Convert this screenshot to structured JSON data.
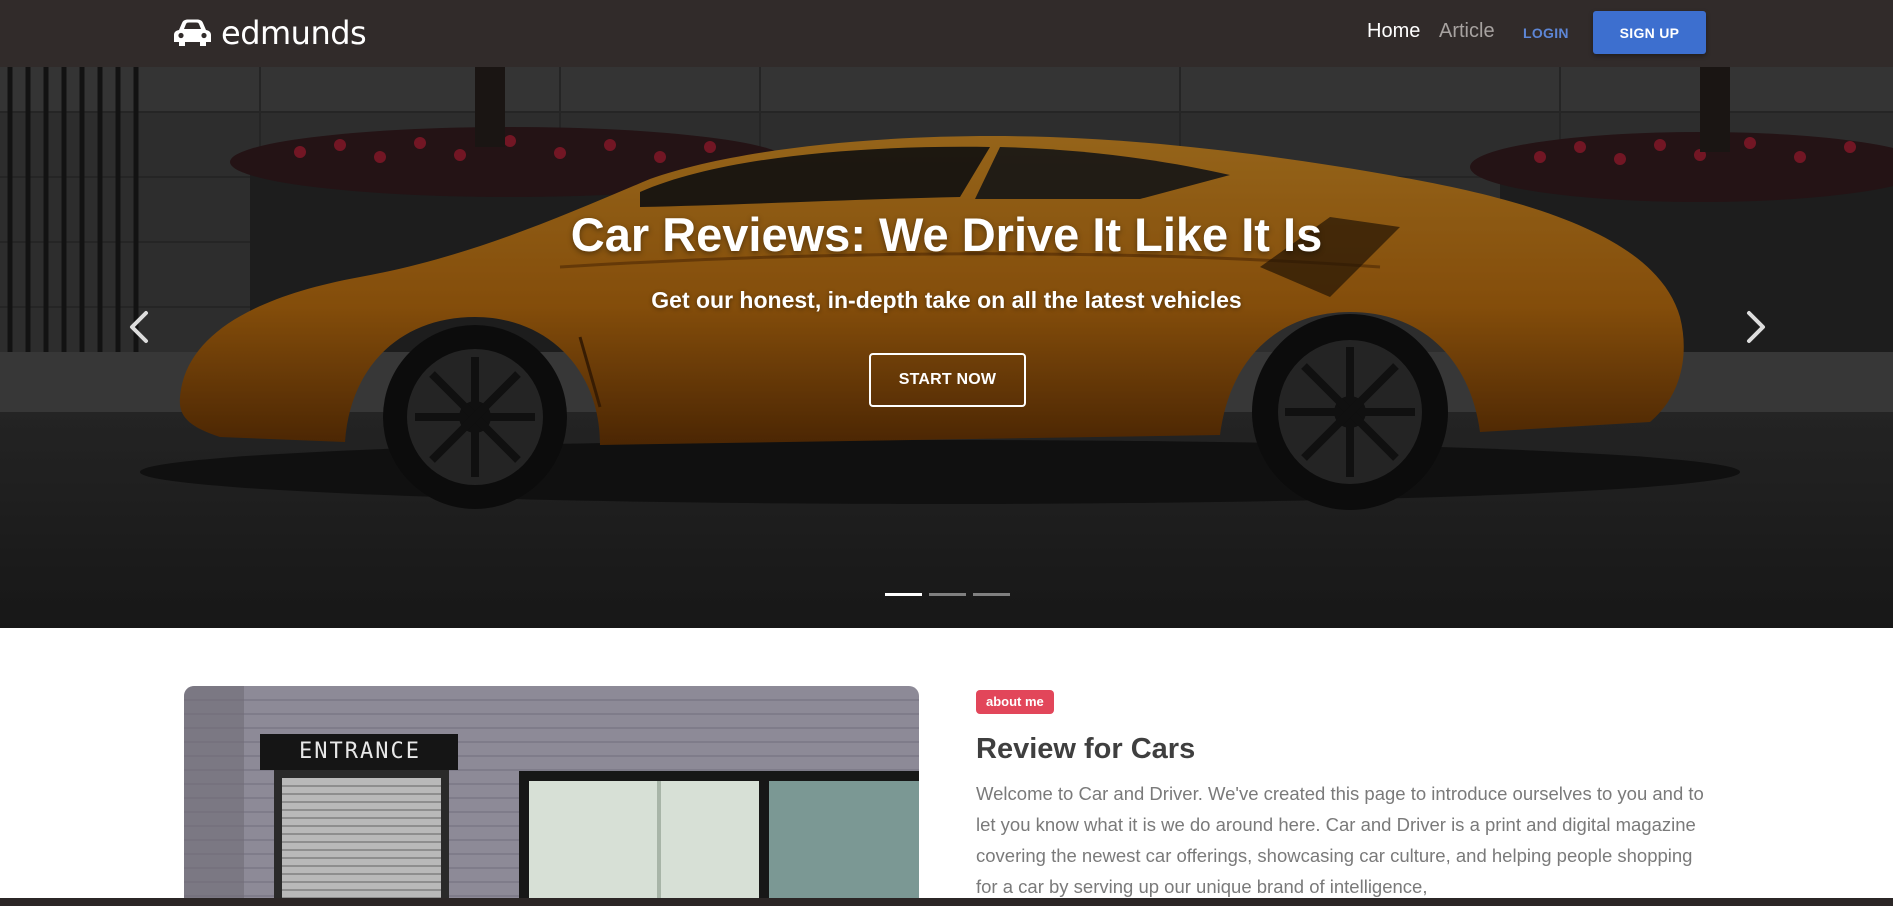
{
  "navbar": {
    "brand": "edmunds",
    "brand_icon": "car-logo-icon",
    "links": [
      {
        "label": "Home",
        "active": true
      },
      {
        "label": "Article",
        "active": false
      }
    ],
    "login_label": "LOGIN",
    "signup_label": "SIGN UP"
  },
  "hero": {
    "title": "Car Reviews: We Drive It Like It Is",
    "subtitle": "Get our honest, in-depth take on all the latest vehicles",
    "cta_label": "START NOW",
    "prev_icon": "chevron-left-icon",
    "next_icon": "chevron-right-icon",
    "slides_count": 3,
    "active_slide": 1
  },
  "about": {
    "badge": "about me",
    "title": "Review for Cars",
    "body": "Welcome to Car and Driver. We've created this page to introduce ourselves to you and to let you know what it is we do around here. Car and Driver is a print and digital magazine covering the newest car offerings, showcasing car culture, and helping people shopping for a car by serving up our unique brand of intelligence,",
    "image_sign_text": "ENTRANCE"
  },
  "colors": {
    "navbar_bg": "#312b2a",
    "accent_blue": "#3d6fcf",
    "badge_red": "#e2465a",
    "car_orange": "#e58d1a"
  }
}
